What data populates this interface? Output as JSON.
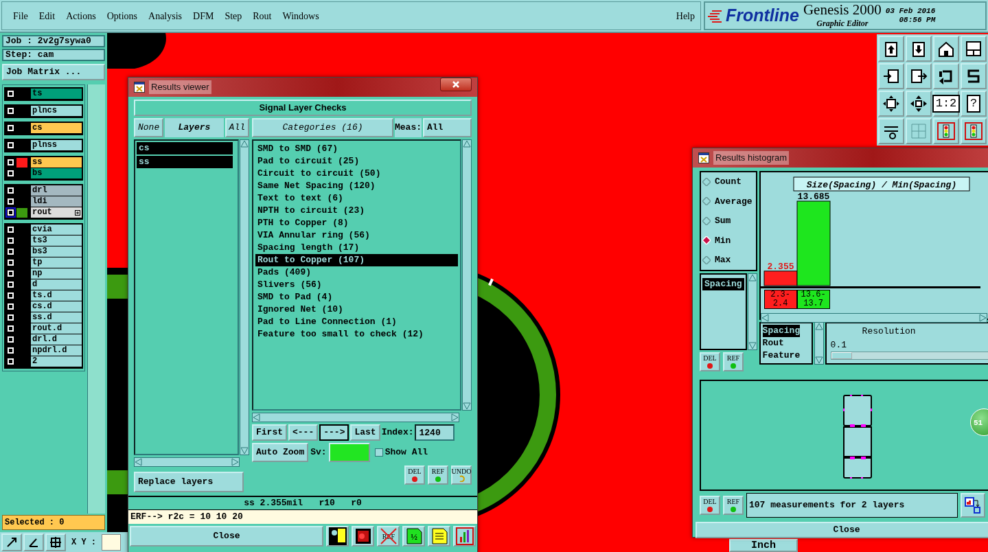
{
  "menu": [
    "File",
    "Edit",
    "Actions",
    "Options",
    "Analysis",
    "DFM",
    "Step",
    "Rout",
    "Windows"
  ],
  "help": "Help",
  "brand": {
    "logo": "Frontline",
    "product": "Genesis 2000",
    "subtitle": "Graphic Editor",
    "date": "03 Feb 2016",
    "time": "08:56 PM"
  },
  "job": {
    "job": "Job : 2v2g7sywa0",
    "step": "Step: cam",
    "matrix_button": "Job Matrix ..."
  },
  "layer_groups": [
    [
      {
        "name": "ts",
        "color": "#00a07a",
        "selected": false,
        "expand": false
      }
    ],
    [
      {
        "name": "plncs",
        "color": "#9edcdc",
        "selected": false,
        "expand": false
      }
    ],
    [
      {
        "name": "cs",
        "color": "#ffc850",
        "selected": false,
        "expand": false
      }
    ],
    [
      {
        "name": "plnss",
        "color": "#9edcdc",
        "selected": false,
        "expand": false
      }
    ],
    [
      {
        "name": "ss",
        "color": "#ffc850",
        "swatch": {
          "color": "#ff1a1a"
        },
        "selected": false,
        "expand": false
      },
      {
        "name": "bs",
        "color": "#00a07a",
        "selected": false,
        "expand": false
      }
    ],
    [
      {
        "name": "drl",
        "color": "#a4b8c0",
        "selected": false,
        "expand": false
      },
      {
        "name": "ldi",
        "color": "#a4b8c0",
        "selected": false,
        "expand": false
      },
      {
        "name": "rout",
        "color": "#dcdcdc",
        "swatch": {
          "color": "#3c9a10"
        },
        "selected": true,
        "expand": true
      }
    ],
    [
      {
        "name": "cvia",
        "color": "#9edcdc",
        "selected": false,
        "expand": false
      },
      {
        "name": "ts3",
        "color": "#9edcdc",
        "selected": false,
        "expand": false
      },
      {
        "name": "bs3",
        "color": "#9edcdc",
        "selected": false,
        "expand": false
      },
      {
        "name": "tp",
        "color": "#9edcdc",
        "selected": false,
        "expand": false
      },
      {
        "name": "np",
        "color": "#9edcdc",
        "selected": false,
        "expand": false
      },
      {
        "name": "d",
        "color": "#9edcdc",
        "selected": false,
        "expand": false
      },
      {
        "name": "ts.d",
        "color": "#9edcdc",
        "selected": false,
        "expand": false
      },
      {
        "name": "cs.d",
        "color": "#9edcdc",
        "selected": false,
        "expand": false
      },
      {
        "name": "ss.d",
        "color": "#9edcdc",
        "selected": false,
        "expand": false
      },
      {
        "name": "rout.d",
        "color": "#9edcdc",
        "selected": false,
        "expand": false
      },
      {
        "name": "drl.d",
        "color": "#9edcdc",
        "selected": false,
        "expand": false
      },
      {
        "name": "npdrl.d",
        "color": "#9edcdc",
        "selected": false,
        "expand": false
      },
      {
        "name": "2",
        "color": "#9edcdc",
        "selected": false,
        "expand": false
      }
    ]
  ],
  "selected_count": "Selected : 0",
  "coords_label": "X Y :",
  "units": "Inch",
  "toolbar": [
    {
      "kind": "page-up"
    },
    {
      "kind": "page-down"
    },
    {
      "kind": "house"
    },
    {
      "kind": "window"
    },
    {
      "kind": "arrow-in"
    },
    {
      "kind": "arrow-out"
    },
    {
      "kind": "loop"
    },
    {
      "kind": "s-curve"
    },
    {
      "kind": "expand"
    },
    {
      "kind": "move"
    },
    {
      "kind": "text",
      "label": "1:2"
    },
    {
      "kind": "text",
      "label": "?"
    },
    {
      "kind": "tools"
    },
    {
      "kind": "grid"
    },
    {
      "kind": "lights"
    },
    {
      "kind": "lights"
    }
  ],
  "viewer": {
    "title": "Results viewer",
    "header": "Signal Layer Checks",
    "none_button": "None",
    "layers_label": "Layers",
    "all_button": "All",
    "layers": [
      {
        "name": "cs",
        "selected": true
      },
      {
        "name": "ss",
        "selected": true
      }
    ],
    "categories_button": "Categories (16)",
    "meas_label": "Meas:",
    "meas_value": "All",
    "categories": [
      {
        "label": "SMD to SMD (67)",
        "selected": false
      },
      {
        "label": "Pad to circuit (25)",
        "selected": false
      },
      {
        "label": "Circuit to circuit (50)",
        "selected": false
      },
      {
        "label": "Same Net Spacing (120)",
        "selected": false
      },
      {
        "label": "Text to text (6)",
        "selected": false
      },
      {
        "label": "NPTH to circuit (23)",
        "selected": false
      },
      {
        "label": "PTH to Copper (8)",
        "selected": false
      },
      {
        "label": "VIA Annular ring (56)",
        "selected": false
      },
      {
        "label": "Spacing length (17)",
        "selected": false
      },
      {
        "label": "Rout to Copper (107)",
        "selected": true
      },
      {
        "label": "Pads (409)",
        "selected": false
      },
      {
        "label": "Slivers (56)",
        "selected": false
      },
      {
        "label": "SMD to Pad (4)",
        "selected": false
      },
      {
        "label": "Ignored Net (10)",
        "selected": false
      },
      {
        "label": "Pad to Line Connection (1)",
        "selected": false
      },
      {
        "label": "Feature too small to check (12)",
        "selected": false
      }
    ],
    "nav": [
      {
        "label": "First",
        "pressed": false
      },
      {
        "label": "<---",
        "pressed": false
      },
      {
        "label": "--->",
        "pressed": true
      },
      {
        "label": "Last",
        "pressed": false
      }
    ],
    "index_label": "Index:",
    "index_value": "1240",
    "zoom_button": "Auto Zoom",
    "sv_label": "Sv:",
    "severity": {
      "color": "#22e522"
    },
    "show_all": {
      "label": "Show All",
      "checked": false
    },
    "actions": [
      "DEL",
      "REF",
      "UNDO"
    ],
    "replace_button": "Replace layers",
    "status": "ss 2.355mil   r10   r0",
    "erf": "ERF--> r2c = 10 10 20",
    "close": "Close",
    "tools": [
      {
        "kind": "figure"
      },
      {
        "kind": "record"
      },
      {
        "kind": "crossed",
        "label": "REF"
      },
      {
        "kind": "page",
        "label": "½"
      },
      {
        "kind": "notes"
      },
      {
        "kind": "histogram"
      }
    ]
  },
  "histogram": {
    "title": "Results histogram",
    "modes": [
      {
        "label": "Count",
        "selected": false
      },
      {
        "label": "Average",
        "selected": false
      },
      {
        "label": "Sum",
        "selected": false
      },
      {
        "label": "Min",
        "selected": true
      },
      {
        "label": "Max",
        "selected": false
      }
    ],
    "measures": [
      {
        "label": "Spacing",
        "selected": true
      }
    ],
    "actions": [
      "DEL",
      "REF"
    ],
    "chart_data": {
      "type": "bar",
      "title": "Size(Spacing) / Min(Spacing)",
      "categories": [
        "2.3-2.4",
        "13.6-13.7"
      ],
      "values": [
        2.355,
        13.685
      ],
      "colors": [
        "#ff1e1e",
        "#1ee61e"
      ],
      "value_labels": [
        "2.355",
        "13.685"
      ]
    },
    "groups": [
      {
        "label": "Spacing",
        "selected": true
      },
      {
        "label": "Rout",
        "selected": false
      },
      {
        "label": "Feature",
        "selected": false
      }
    ],
    "resolution_label": "Resolution",
    "resolution_value": "0.1",
    "resolution": {
      "level": 0
    },
    "badge": "51",
    "preview_actions": [
      "DEL",
      "REF"
    ],
    "summary": "107 measurements for 2 layers",
    "close": "Close"
  }
}
